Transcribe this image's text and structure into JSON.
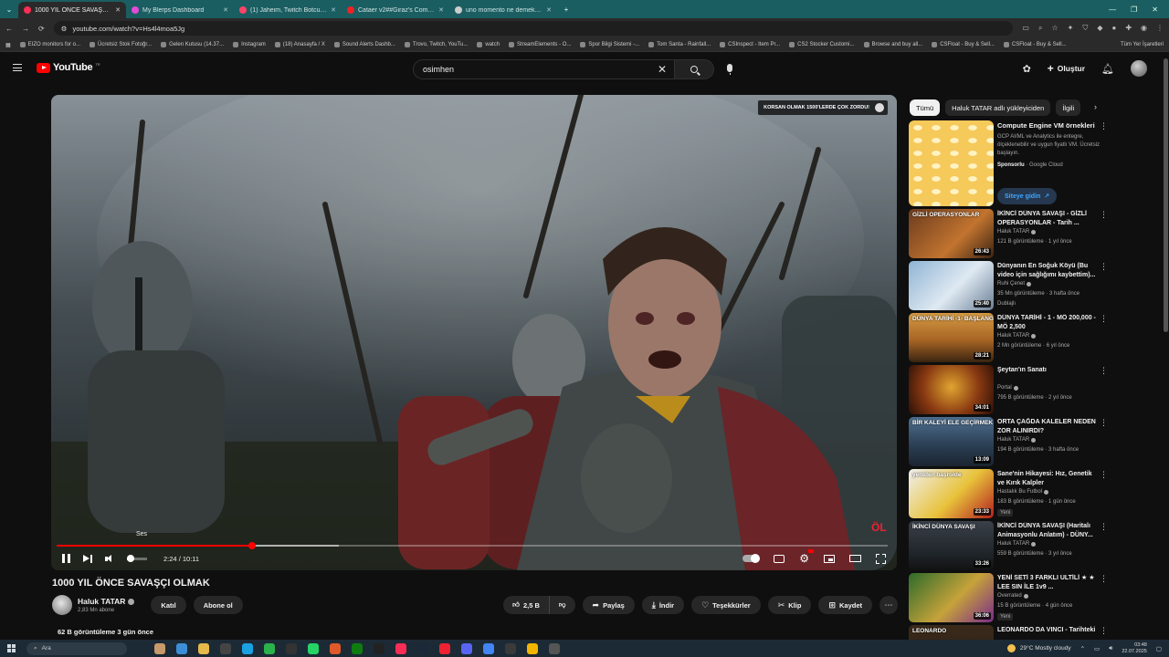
{
  "browser": {
    "tabs": [
      {
        "title": "1000 YIL ÖNCE SAVAŞÇI OLMAK",
        "favicon_color": "#ff2d55",
        "active": true
      },
      {
        "title": "My Blerps Dashboard",
        "favicon_color": "#e44ad8",
        "active": false
      },
      {
        "title": "(1) Jaheim, Twitch Botcusuyla",
        "favicon_color": "#ff4466",
        "active": false
      },
      {
        "title": "Cataer v2##Giraz's Competitive",
        "favicon_color": "#e22",
        "active": false
      },
      {
        "title": "uno momento ne demek - Goo",
        "favicon_color": "#cccccc",
        "active": false
      }
    ],
    "url": "youtube.com/watch?v=Hs4l4moa5Jg",
    "bookmarks": [
      "EIZO monitors for o...",
      "Ücretsiz Stok Fotoğr...",
      "Gelen Kutusu (14.37...",
      "Instagram",
      "(18) Anasayfa / X",
      "Sound Alerts Dashb...",
      "Trovo, Twitch, YouTu...",
      "watch",
      "StreamElements - O...",
      "Spor Bilgi Sistemi -...",
      "Tom Santa - Rainfall...",
      "CSInspect - Item Pr...",
      "CS2 Stocker Customi...",
      "Browse and buy all...",
      "CSFloat - Buy & Sell...",
      "CSFloat - Buy & Sell..."
    ],
    "bookmarks_right": "Tüm Yer İşaretleri"
  },
  "header": {
    "logo_text": "YouTube",
    "logo_sup": "TR",
    "search_value": "osimhen",
    "create_label": "Oluştur"
  },
  "player": {
    "badge_text": "KORSAN OLMAK 1500'LERDE ÇOK ZORDU!",
    "tooltip": "Ses",
    "time_current": "2:24",
    "time_separator": " / ",
    "time_total": "10:11",
    "progress_fraction": 0.2356,
    "buffer_fraction": 0.34,
    "volume_fraction": 0.2,
    "corner_logo": "ÖL"
  },
  "video": {
    "title": "1000 YIL ÖNCE SAVAŞÇI OLMAK",
    "channel": "Haluk TATAR",
    "subscribers": "2,83 Mn abone",
    "join_label": "Katıl",
    "subscribe_label": "Abone ol",
    "likes": "2,5 B",
    "share_label": "Paylaş",
    "download_label": "İndir",
    "thanks_label": "Teşekkürler",
    "clip_label": "Klip",
    "save_label": "Kaydet",
    "views_line": "62 B görüntüleme  3 gün önce"
  },
  "sidebar": {
    "chips": [
      "Tümü",
      "Haluk TATAR adlı yükleyiciden",
      "İlgili"
    ],
    "ad": {
      "title": "Compute Engine VM örnekleri",
      "description": "GCP AI/ML ve Analytics ile entegre, ölçeklenebilir ve uygun fiyatlı VM. Ücretsiz başlayın.",
      "sponsor_label": "Sponsorlu",
      "sponsor_sep": " · ",
      "advertiser": "Google Cloud",
      "cta": "Siteye gidin"
    },
    "recommendations": [
      {
        "title": "İKİNCİ DÜNYA SAVAŞI - GİZLİ OPERASYONLAR - Tarih ...",
        "channel": "Haluk TATAR",
        "meta": "121 B görüntüleme · 1 yıl önce",
        "duration": "26:43",
        "thumb_text": "GİZLİ OPERASYONLAR",
        "extra": "",
        "thumb_bg": "linear-gradient(135deg,#6b3b1e,#c2742f 60%,#3b2312)"
      },
      {
        "title": "Dünyanın En Soğuk Köyü (Bu video için sağlığımı kaybettim)...",
        "channel": "Ruhi Çenet",
        "meta": "35 Mn görüntüleme · 3 hafta önce",
        "duration": "25:40",
        "thumb_text": "",
        "extra": "Dublajlı",
        "thumb_bg": "linear-gradient(135deg,#8fb4d4,#dfe9f2 55%,#6b7f96)"
      },
      {
        "title": "DÜNYA TARİHİ - 1 - MÖ 200,000 - MÖ 2,500",
        "channel": "Haluk TATAR",
        "meta": "2 Mn görüntüleme · 6 yıl önce",
        "duration": "28:21",
        "thumb_text": "DÜNYA TARİHİ -1- BAŞLANGIÇ",
        "extra": "",
        "thumb_bg": "linear-gradient(180deg,#d49a43,#a86424 55%,#3a2410)"
      },
      {
        "title": "Şeytan'ın Sanatı",
        "channel": "Portal",
        "meta": "795 B görüntüleme · 2 yıl önce",
        "duration": "34:01",
        "thumb_text": "",
        "extra": "",
        "thumb_bg": "radial-gradient(circle at 50% 45%,#e0a530,#8a3a12 55%,#2a0f06)"
      },
      {
        "title": "ORTA ÇAĞDA KALELER NEDEN ZOR ALINIRDI?",
        "channel": "Haluk TATAR",
        "meta": "194 B görüntüleme · 3 hafta önce",
        "duration": "13:09",
        "thumb_text": "BİR KALEYİ ELE GEÇİRMEK",
        "extra": "",
        "thumb_bg": "linear-gradient(180deg,#4e6e8e,#2a3d52 60%,#1b2430)"
      },
      {
        "title": "Sane'nin Hikayesi: Hız, Genetik ve Kırık Kalpler",
        "channel": "Hastalık Bu Futbol",
        "meta": "183 B görüntüleme · 1 gün önce",
        "duration": "23:33",
        "thumb_text": "yeniden başrolde",
        "extra": "Yeni",
        "thumb_bg": "linear-gradient(135deg,#f0f0f0,#e8c23a 55%,#b21f1f)"
      },
      {
        "title": "İKİNCİ DÜNYA SAVAŞI (Haritalı Animasyonlu Anlatım) - DÜNY...",
        "channel": "Haluk TATAR",
        "meta": "559 B görüntüleme · 3 yıl önce",
        "duration": "33:26",
        "thumb_text": "İKİNCİ DÜNYA SAVAŞI",
        "extra": "",
        "thumb_bg": "linear-gradient(180deg,#3a4048,#1e2328 70%,#111)"
      },
      {
        "title": "YENİ SETİ 3 FARKLI ULTİLİ ★ ★ LEE SIN İLE 1v9 ...",
        "channel": "Overrated",
        "meta": "15 B görüntüleme · 4 gün önce",
        "duration": "36:06",
        "thumb_text": "",
        "extra": "Yeni",
        "thumb_bg": "linear-gradient(135deg,#2d6b2a,#c6a23a 55%,#7a2a8a)"
      },
      {
        "title": "LEONARDO DA VINCI - Tarihteki",
        "channel": "",
        "meta": "",
        "duration": "",
        "thumb_text": "LEONARDO",
        "extra": "",
        "thumb_bg": "linear-gradient(180deg,#3b2a1a,#2a1e14)"
      }
    ]
  },
  "taskbar": {
    "search_placeholder": "Ara",
    "weather": "29°C  Mostly cloudy",
    "time": "03:48",
    "date": "22.07.2025"
  },
  "colors": {
    "accent": "#ff0000",
    "link": "#3ea6ff",
    "tabstrip": "#1b5e62"
  }
}
